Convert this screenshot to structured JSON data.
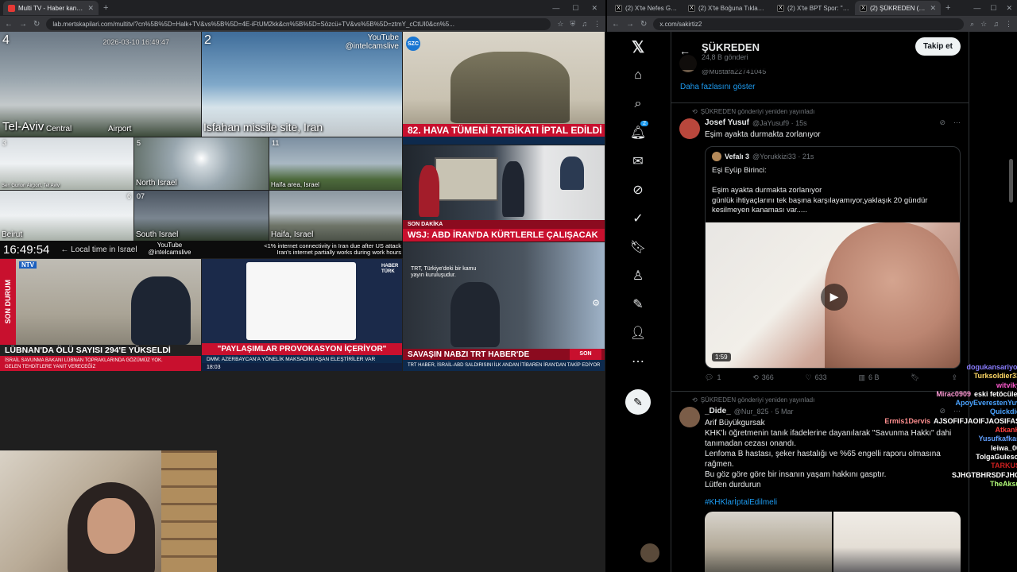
{
  "left_window": {
    "tabs": [
      {
        "label": "Multi TV - Haber kanallarını aynı",
        "active": true
      }
    ],
    "url": "lab.mertskapilari.com/multitv/?cn%5B%5D=Halk+TV&vs%5B%5D=4E-iFtUM2kk&cn%5B%5D=Sözcü+TV&vs%5B%5D=ztmY_cCtUI0&cn%5..."
  },
  "right_window": {
    "tabs": [
      {
        "label": "(2) X'te Nefes Gazetesi: \"İsteı",
        "active": false
      },
      {
        "label": "(2) X'te Boğuna Tıklama: \"Do",
        "active": false
      },
      {
        "label": "(2) X'te BPT Spor: \"Al-Nassr",
        "active": false
      },
      {
        "label": "(2) ŞÜKREDEN (@sakirt",
        "active": true
      }
    ],
    "url": "x.com/sakirtiz2"
  },
  "cams": {
    "telaviv": {
      "num": "4",
      "label": "Tel-Aviv",
      "sub1": "Central",
      "sub2": "Airport"
    },
    "isfahan": {
      "num": "2",
      "label": "Isfahan missile site, Iran",
      "yt": "YouTube\n@intelcamslive"
    },
    "c3": {
      "num": "3",
      "label": "Ben Gurion Airport, Tel Aviv"
    },
    "north": {
      "num": "5",
      "label": "North Israel"
    },
    "c11": {
      "num": "11",
      "label": "Haifa area, Israel"
    },
    "beirut": {
      "num": "6",
      "label": "Beirut"
    },
    "southisr": {
      "num": "07",
      "label": "South Israel"
    },
    "haifa": {
      "num": "",
      "label": "Haifa, Israel"
    },
    "clock": "16:49:54",
    "local": "← Local time in Israel",
    "yt_bottom": "YouTube\n@intelcamslive",
    "iran_note": "<1% internet connectivity in Iran due after US attack\nIran's internet partially works during work hours"
  },
  "news": {
    "szc_headline": "82. HAVA TÜMENİ TATBİKATI İPTAL EDİLDİ",
    "cnn_headline": "WSJ: ABD İRAN'DA KÜRTLERLE ÇALIŞACAK",
    "cnn_breaking": "SON DAKİKA",
    "ntv_side": "SON DURUM",
    "ntv_headline": "LÜBNAN'DA ÖLÜ SAYISI 294'E YÜKSELDİ",
    "ntv_sub": "İSRAİL SAVUNMA BAKANI LÜBNAN TOPRAKLARINDA GÖZÜMÜZ YOK. GELEN TEHDİTLERE YANIT VERECEĞİZ",
    "ntv_time": "18:04",
    "haber_headline": "\"PAYLAŞIMLAR PROVOKASYON İÇERİYOR\"",
    "haber_sub": "DMM: AZERBAYCAN'A YÖNELİK MAKSADINI AŞAN ELEŞTİRİLER VAR",
    "haber_time": "18:03",
    "trt_headline": "SAVAŞIN NABZI TRT HABER'DE",
    "trt_sub": "TRT HABER, İSRAİL-ABD SALDIRISINI İLK ANDAN İTİBAREN İRAN'DAN TAKİP EDİYOR",
    "trt_badge": "SON DAKİKA",
    "trt_caption": "TRT, Türkiye'deki bir kamu yayın kuruluşudur.",
    "haberturk": "HABER TÜRK"
  },
  "x": {
    "profile_name": "ŞÜKREDEN",
    "post_count": "24,8 B gönderi",
    "follow_label": "Takip et",
    "profile_handle": "@Mustafa22741045",
    "show_more": "Daha fazlasını göster",
    "nav_badge": "2",
    "tweets": [
      {
        "retweet_label": "ŞÜKREDEN gönderiyi yeniden yayınladı",
        "name": "Josef Yusuf",
        "handle": "@JaYusuf9 · 15s",
        "text": "Eşim ayakta durmakta zorlanıyor",
        "quote": {
          "name": "Vefalı 3",
          "handle": "@Yorukkizi33 · 21s",
          "text": "Eşi Eyüp Birinci:\n\nEşim ayakta durmakta zorlanıyor\ngünlük ihtiyaçlarını tek başına karşılayamıyor,yaklaşık 20 gündür kesilmeyen kanaması var.....",
          "duration": "1:59"
        },
        "replies": "1",
        "reposts": "366",
        "likes": "633",
        "views": "6 B"
      },
      {
        "retweet_label": "ŞÜKREDEN gönderiyi yeniden yayınladı",
        "name": "_Dide_",
        "handle": "@Nur_825 · 5 Mar",
        "text": "Arif Büyükgursak\nKHK'lı öğretmenin tanık ifadelerine dayanılarak \"Savunma Hakkı\" dahi tanımadan cezası onandı.\nLenfoma B hastası, şeker hastalığı ve %65 engelli raporu olmasına rağmen.\nBu göz göre göre bir insanın yaşam hakkını gasptır.\nLütfen durdurun",
        "hashtag": "#KHKlarİptalEdilmeli"
      }
    ]
  },
  "chat": [
    {
      "user": "dogukansariyor",
      "color": "#8a7dff",
      "msg": ""
    },
    {
      "user": "Turksoldier33",
      "color": "#ffd966",
      "msg": ""
    },
    {
      "user": "witviky",
      "color": "#ff5ad1",
      "msg": ""
    },
    {
      "user": "Mirac0909",
      "color": "#ff9ad5",
      "msg": "eski fetöcüler"
    },
    {
      "user": "ApoyEverestenYuv",
      "color": "#4aa3ff",
      "msg": ""
    },
    {
      "user": "Quickdie",
      "color": "#4aa3ff",
      "msg": ""
    },
    {
      "user": "Ermis1Dervis",
      "color": "#ff8f8f",
      "msg": "AJSOFIFJAOIFJAOSIFAS"
    },
    {
      "user": "AtkanK",
      "color": "#ff4040",
      "msg": ""
    },
    {
      "user": "Yusufkafkas",
      "color": "#62a0ff",
      "msg": ""
    },
    {
      "user": "leiwa_00",
      "color": "#ffffff",
      "msg": ""
    },
    {
      "user": "TolgaGulesci",
      "color": "#ffffff",
      "msg": ""
    },
    {
      "user": "TARKUS",
      "color": "#d02020",
      "msg": ""
    },
    {
      "user": "",
      "color": "#ffffff",
      "msg": "SJHGTBHRSDFJHG"
    },
    {
      "user": "TheAksu",
      "color": "#b4ff7a",
      "msg": ""
    }
  ]
}
